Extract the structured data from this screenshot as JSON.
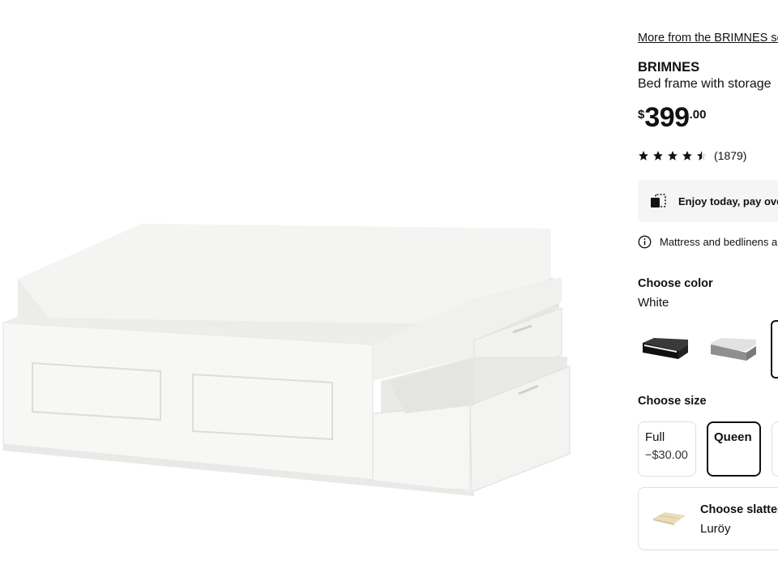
{
  "product_image": {
    "alt": "",
    "icon": "bed-frame-with-storage-photo"
  },
  "product": {
    "more_link": "More from the BRIMNES series",
    "name": "BRIMNES",
    "description": "Bed frame with storage",
    "price": {
      "currency": "$",
      "integer": "399",
      "decimal": ".00"
    },
    "rating": {
      "stars": 4.5,
      "count": "(1879)"
    }
  },
  "promo": {
    "icon": "financing-icon",
    "text": "Enjoy today, pay over time"
  },
  "notice": {
    "icon": "info-icon",
    "text": "Mattress and bedlinens are sold separately"
  },
  "color": {
    "label": "Choose color",
    "selected": "White",
    "swatches": [
      {
        "name": "black",
        "color": "#1a1a1a"
      },
      {
        "name": "grey",
        "color": "#9a9a9a"
      },
      {
        "name": "white",
        "color": "#ffffff",
        "selected": true
      }
    ]
  },
  "size": {
    "label": "Choose size",
    "options": [
      {
        "name": "Full",
        "delta": "−$30.00",
        "selected": false
      },
      {
        "name": "Queen",
        "delta": "",
        "selected": true
      },
      {
        "name": "",
        "delta": "",
        "selected": false
      }
    ]
  },
  "slats": {
    "title": "Choose slatted bed base",
    "value": "Luröy",
    "icon": "slatted-bed-base-icon"
  },
  "colors": {
    "text": "#111111",
    "border": "#dfdfdf",
    "promo_bg": "#f5f5f5"
  }
}
